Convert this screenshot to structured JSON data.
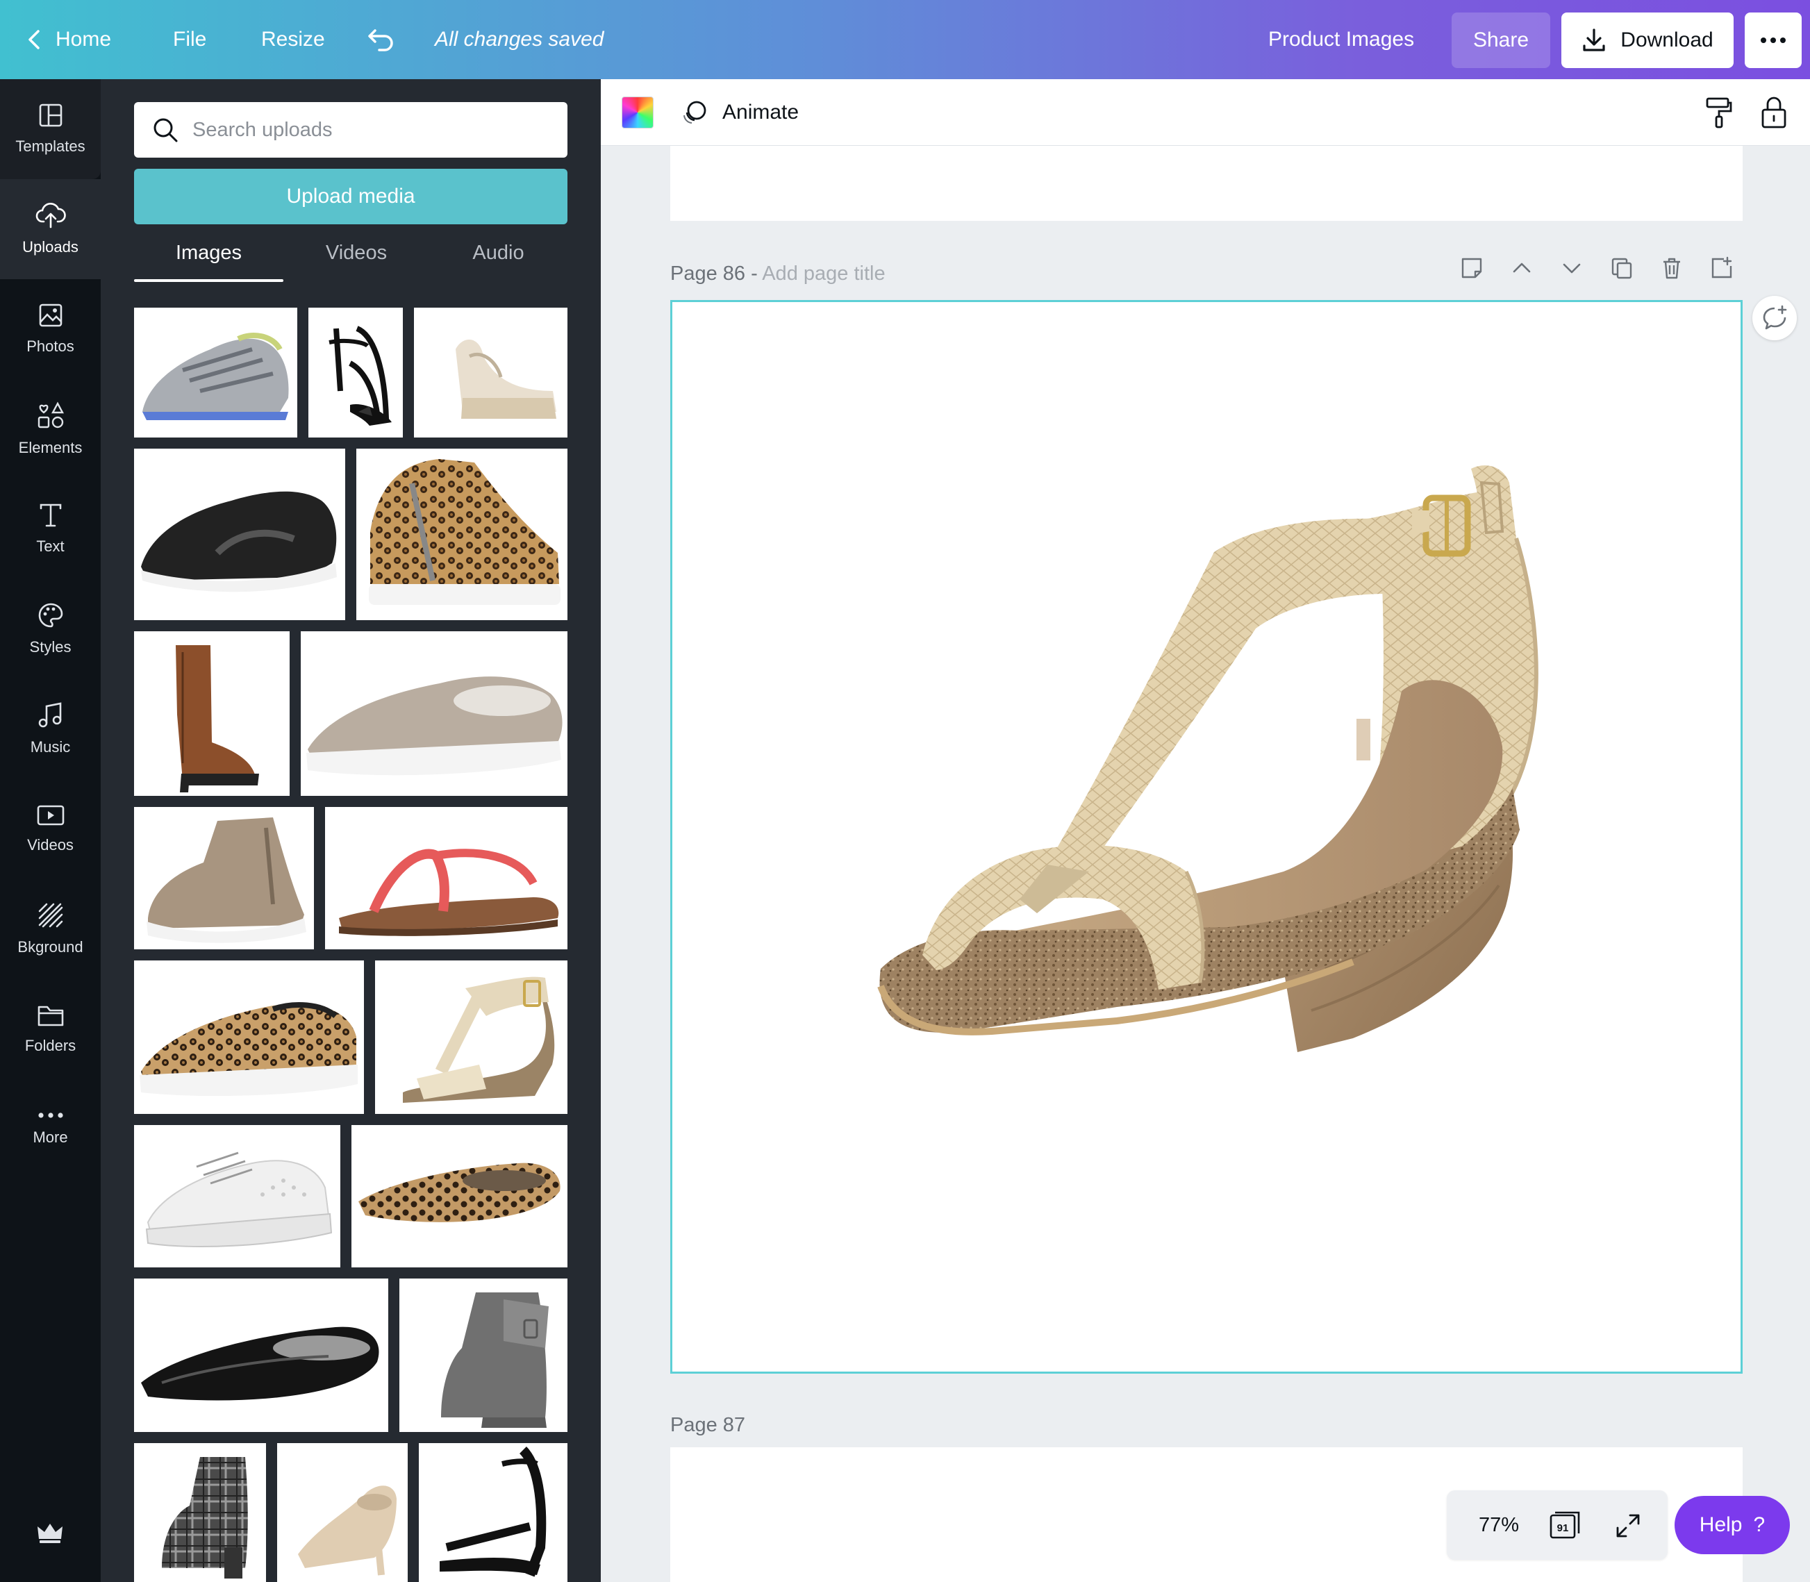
{
  "topbar": {
    "home_label": "Home",
    "file_label": "File",
    "resize_label": "Resize",
    "saved_status": "All changes saved",
    "design_title": "Product Images",
    "share_label": "Share",
    "download_label": "Download"
  },
  "leftnav": {
    "items": [
      {
        "label": "Templates",
        "icon": "templates-icon"
      },
      {
        "label": "Uploads",
        "icon": "upload-cloud-icon"
      },
      {
        "label": "Photos",
        "icon": "photo-icon"
      },
      {
        "label": "Elements",
        "icon": "shapes-icon"
      },
      {
        "label": "Text",
        "icon": "text-icon"
      },
      {
        "label": "Styles",
        "icon": "palette-icon"
      },
      {
        "label": "Music",
        "icon": "music-note-icon"
      },
      {
        "label": "Videos",
        "icon": "video-icon"
      },
      {
        "label": "Bkground",
        "icon": "background-hatch-icon"
      },
      {
        "label": "Folders",
        "icon": "folder-icon"
      },
      {
        "label": "More",
        "icon": "more-dots-icon"
      }
    ]
  },
  "uploads": {
    "search_placeholder": "Search uploads",
    "upload_button": "Upload media",
    "tabs": [
      "Images",
      "Videos",
      "Audio"
    ],
    "active_tab": "Images",
    "images": [
      "gray-blue-running-sneaker",
      "black-ankle-strap-heel",
      "cream-wedge-sandal",
      "black-running-sneaker",
      "leopard-high-top-sneaker",
      "brown-knee-high-boot",
      "taupe-slip-on-sneaker",
      "taupe-wedge-ankle-bootie",
      "red-thong-sandal",
      "leopard-slip-on-sneaker",
      "gold-t-strap-wedge-sandal",
      "white-studded-low-top-sneaker",
      "leopard-ballet-flat",
      "black-patent-ballet-flat",
      "gray-wedge-ankle-boot",
      "plaid-block-heel-bootie",
      "nude-pump",
      "black-strappy-heel"
    ]
  },
  "editor": {
    "animate_label": "Animate",
    "page_86_label": "Page 86 - ",
    "page_86_title_placeholder": "Add page title",
    "page_86_image": "gold-t-strap-wedge-sandal",
    "page_87_label": "Page 87",
    "zoom": "77%",
    "page_count": "91",
    "help_label": "Help",
    "help_mark": "?"
  },
  "colors": {
    "topbar_gradient_start": "#41c0d0",
    "topbar_gradient_end": "#7b4fe0",
    "upload_button": "#5ac2cc",
    "selected_page_border": "#5dd0d6",
    "help_button": "#7c3aed",
    "sidebar_bg": "#0e1318",
    "panel_bg": "#252a31"
  }
}
